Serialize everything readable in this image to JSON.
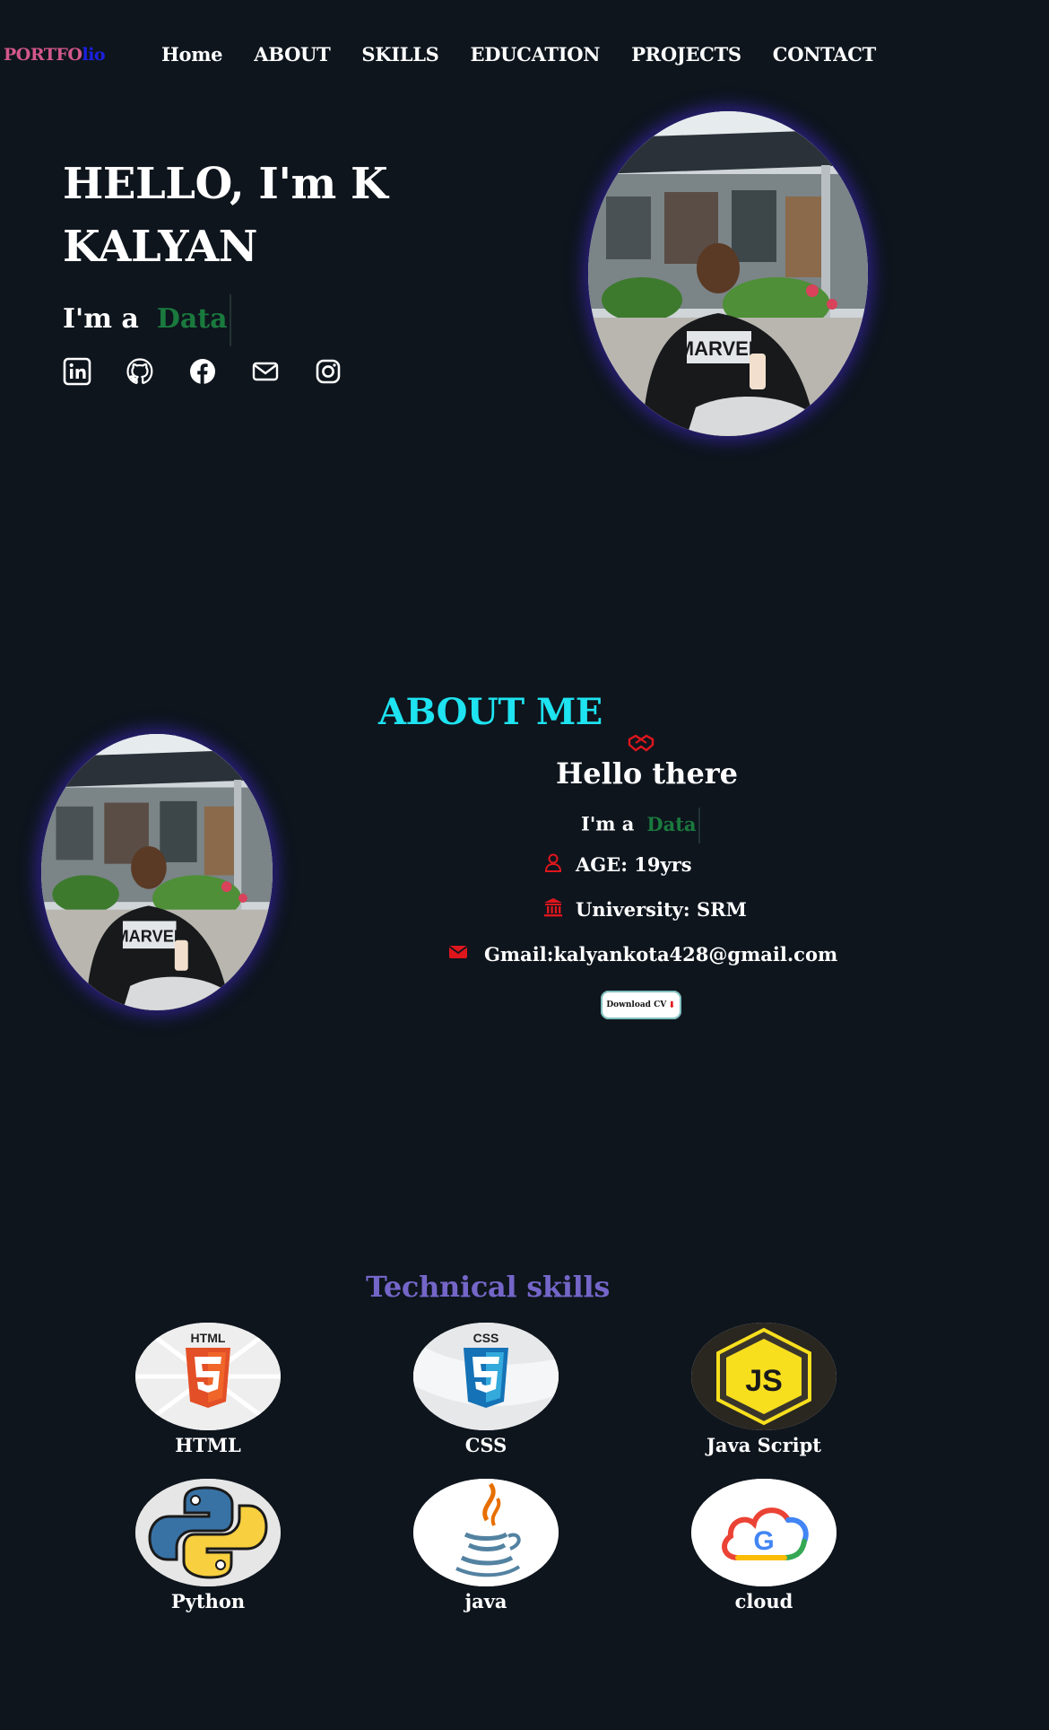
{
  "nav": {
    "logo_a": "PORTFO",
    "logo_b": "lio",
    "items": [
      "Home",
      "ABOUT",
      "SKILLS",
      "EDUCATION",
      "PROJECTS",
      "CONTACT"
    ]
  },
  "hero": {
    "title": "HELLO, I'm K KALYAN",
    "prefix": "I'm  a",
    "role": "Data",
    "socials": [
      "linkedin-icon",
      "github-icon",
      "facebook-icon",
      "mail-icon",
      "instagram-icon"
    ]
  },
  "about": {
    "title": "ABOUT ME",
    "hello": "Hello there",
    "prefix": "I'm  a",
    "role": "Data",
    "age": "AGE: 19yrs",
    "university": "University: SRM",
    "gmail": "Gmail:kalyankota428@gmail.com",
    "download": "Download CV"
  },
  "skills": {
    "title": "Technical skills",
    "items": [
      "HTML",
      "CSS",
      "Java Script",
      "Python",
      "java",
      "cloud"
    ]
  },
  "colors": {
    "background": "#0e151d",
    "about_title": "#1ee3f0",
    "skills_title": "#7466c8",
    "role_text": "#1a7a3e",
    "info_icons": "#e0161d"
  }
}
